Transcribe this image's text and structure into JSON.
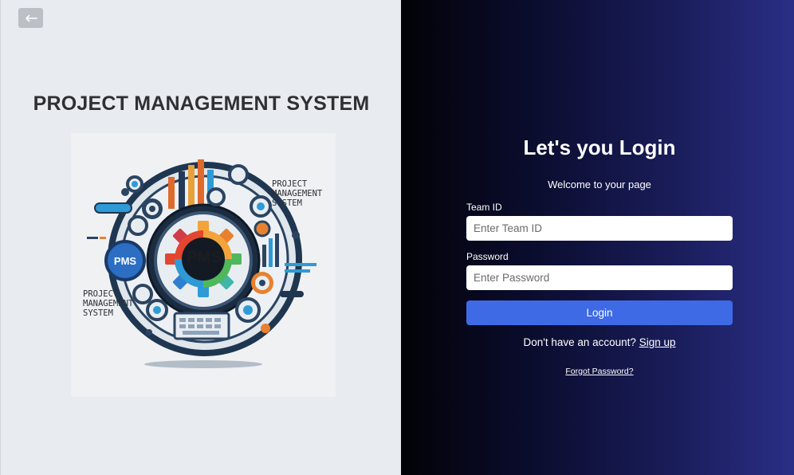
{
  "left": {
    "back_icon": "arrow-left-icon",
    "title": "PROJECT MANAGEMENT SYSTEM",
    "illustration": {
      "badge_center": "PMS",
      "badge_small": "PMS",
      "caption_right": "PROJECT\nMANAGEMENT\nSYSTEM",
      "caption_left": "PROJECT\nMANAGEMENT\nSYSTEM"
    }
  },
  "login": {
    "heading": "Let's you Login",
    "welcome": "Welcome to your page",
    "team_id_label": "Team ID",
    "team_id_placeholder": "Enter Team ID",
    "password_label": "Password",
    "password_placeholder": "Enter Password",
    "login_button": "Login",
    "signup_prompt": "Don't have an account?",
    "signup_link": "Sign up",
    "forgot_link": "Forgot Password?"
  },
  "colors": {
    "left_bg": "#e8ebf0",
    "right_gradient_start": "#020207",
    "right_gradient_end": "#2a2e86",
    "button_blue": "#3f6ae6",
    "title_text": "#2f3033"
  }
}
